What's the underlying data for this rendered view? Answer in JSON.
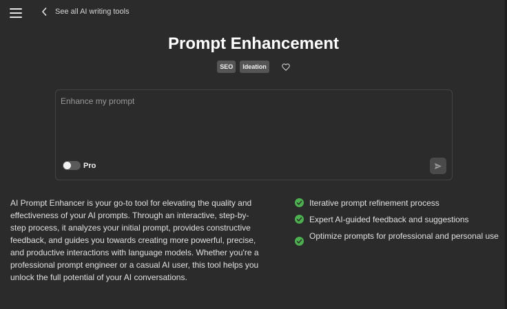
{
  "nav": {
    "back_label": "See all AI writing tools"
  },
  "header": {
    "title": "Prompt Enhancement",
    "tags": [
      "SEO",
      "Ideation"
    ]
  },
  "prompt": {
    "placeholder": "Enhance my prompt",
    "value": "",
    "pro_label": "Pro",
    "pro_enabled": false
  },
  "description": "AI Prompt Enhancer is your go-to tool for elevating the quality and effectiveness of your AI prompts. Through an interactive, step-by-step process, it analyzes your initial prompt, provides constructive feedback, and guides you towards creating more powerful, precise, and productive interactions with language models. Whether you're a professional prompt engineer or a casual AI user, this tool helps you unlock the full potential of your AI conversations.",
  "features": [
    "Iterative prompt refinement process",
    "Expert AI-guided feedback and suggestions",
    "Optimize prompts for professional and personal use"
  ],
  "icons": {
    "menu": "hamburger-icon",
    "back": "chevron-left-icon",
    "favorite": "heart-icon",
    "send": "send-icon",
    "feature_check": "check-circle-icon"
  },
  "colors": {
    "background": "#2b2b2b",
    "check_green": "#4caf50",
    "tag_bg": "#555555"
  }
}
